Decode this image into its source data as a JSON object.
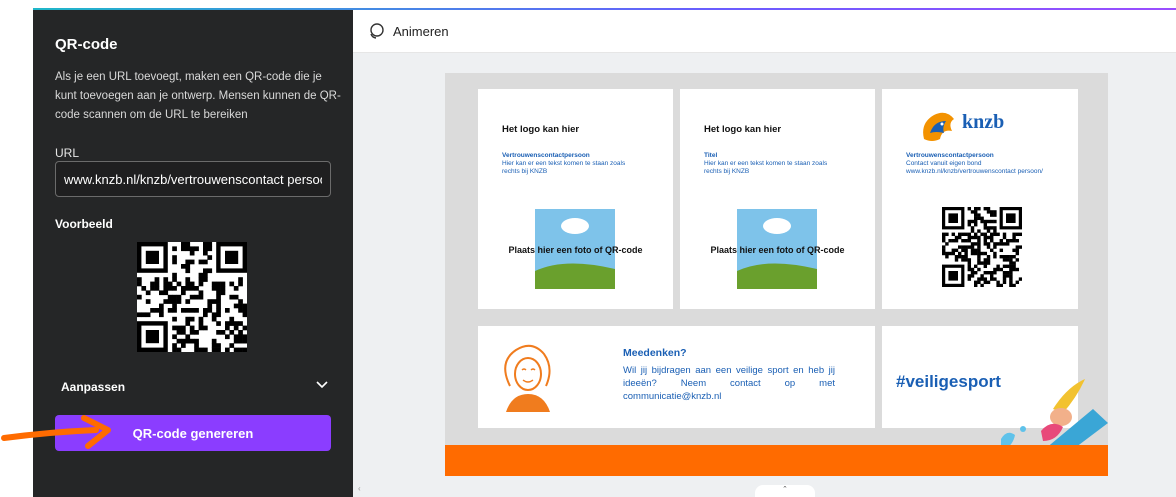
{
  "panel": {
    "title": "QR-code",
    "description": "Als je een URL toevoegt, maken een QR-code die je kunt toevoegen aan je ontwerp. Mensen kunnen de QR-code scannen om de URL te bereiken",
    "url_label": "URL",
    "url_value": "www.knzb.nl/knzb/vertrouwenscontact persoon/",
    "preview_label": "Voorbeeld",
    "customize_label": "Aanpassen",
    "generate_button": "QR-code genereren"
  },
  "toolbar": {
    "animate_label": "Animeren"
  },
  "design": {
    "card1": {
      "title": "Het logo kan hier",
      "sub_title": "Vertrouwenscontactpersoon",
      "sub_text": "Hier kan er een tekst komen te staan zoals rechts bij KNZB",
      "photo_label": "Plaats hier een foto of QR-code"
    },
    "card2": {
      "title": "Het logo kan hier",
      "sub_title": "Titel",
      "sub_text": "Hier kan er een tekst komen te staan zoals rechts bij KNZB",
      "photo_label": "Plaats hier een foto of QR-code"
    },
    "card3": {
      "logo_text": "knzb",
      "sub_title": "Vertrouwenscontactpersoon",
      "sub_text": "Contact vanuit eigen bond www.knzb.nl/knzb/vertrouwenscontact persoon/"
    },
    "card4": {
      "title": "Meedenken?",
      "text": "Wil jij bijdragen aan een veilige sport en heb jij ideeën? Neem contact op met communicatie@knzb.nl"
    },
    "card5": {
      "hashtag": "#veiligesport"
    }
  },
  "colors": {
    "panel_bg": "#252627",
    "accent_purple": "#8b3dff",
    "arrow_orange": "#ff6b00",
    "knzb_blue": "#1a5fb4",
    "orange_bar": "#ff6b00"
  },
  "icons": {
    "animate": "animate-icon",
    "chevron": "chevron-down-icon",
    "collapse": "chevron-left-icon",
    "scroll_up": "chevron-up-icon"
  }
}
